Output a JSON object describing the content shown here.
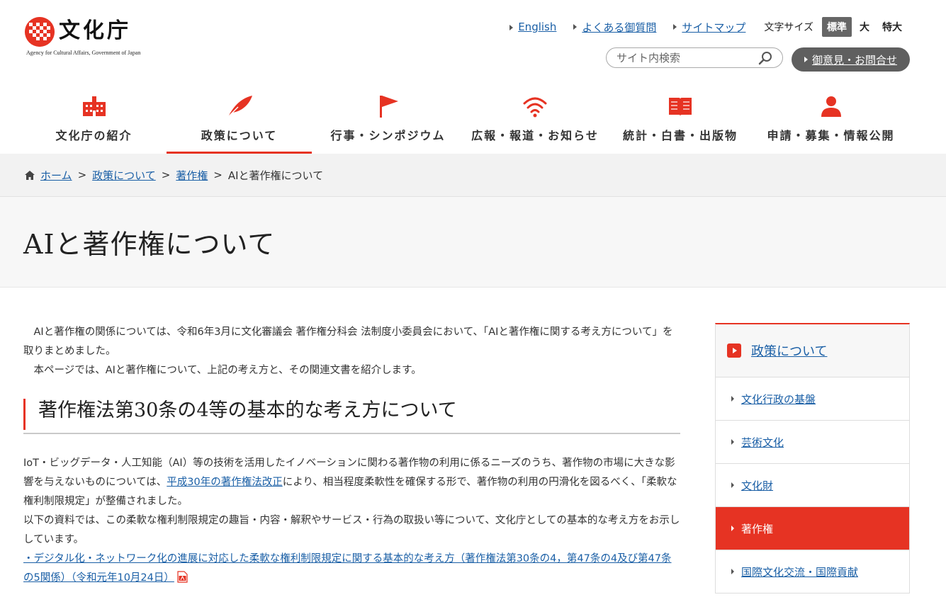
{
  "header": {
    "logo_text": "文化庁",
    "logo_subtitle": "Agency for Cultural Affairs, Government of Japan",
    "links": [
      "English",
      "よくある御質問",
      "サイトマップ"
    ],
    "font_size_label": "文字サイズ",
    "font_sizes": [
      "標準",
      "大",
      "特大"
    ],
    "search_placeholder": "サイト内検索",
    "contact_label": "御意見・お問合せ"
  },
  "nav": {
    "items": [
      {
        "label": "文化庁の紹介",
        "icon": "building-icon"
      },
      {
        "label": "政策について",
        "icon": "quill-icon"
      },
      {
        "label": "行事・シンポジウム",
        "icon": "flag-icon"
      },
      {
        "label": "広報・報道・お知らせ",
        "icon": "broadcast-icon"
      },
      {
        "label": "統計・白書・出版物",
        "icon": "book-icon"
      },
      {
        "label": "申請・募集・情報公開",
        "icon": "person-icon"
      }
    ],
    "active_index": 1
  },
  "breadcrumb": {
    "items": [
      "ホーム",
      "政策について",
      "著作権"
    ],
    "current": "AIと著作権について"
  },
  "page": {
    "title": "AIと著作権について"
  },
  "content": {
    "intro": [
      "AIと著作権の関係については、令和6年3月に文化審議会 著作権分科会 法制度小委員会において、「AIと著作権に関する考え方について」を取りまとめました。",
      "本ページでは、AIと著作権について、上記の考え方と、その関連文書を紹介します。"
    ],
    "section_heading": "著作権法第30条の4等の基本的な考え方について",
    "para1_before": "IoT・ビッグデータ・人工知能（AI）等の技術を活用したイノベーションに関わる著作物の利用に係るニーズのうち、著作物の市場に大きな影響を与えないものについては、",
    "para1_link": "平成30年の著作権法改正",
    "para1_after": "により、相当程度柔軟性を確保する形で、著作物の利用の円滑化を図るべく、「柔軟な権利制限規定」が整備されました。",
    "para2": "以下の資料では、この柔軟な権利制限規定の趣旨・内容・解釈やサービス・行為の取扱い等について、文化庁としての基本的な考え方をお示ししています。",
    "doc_link": "・デジタル化・ネットワーク化の進展に対応した柔軟な権利制限規定に関する基本的な考え方（著作権法第30条の4，第47条の4及び第47条の5関係）（令和元年10月24日）"
  },
  "sidebar": {
    "heading": "政策について",
    "items": [
      "文化行政の基盤",
      "芸術文化",
      "文化財",
      "著作権",
      "国際文化交流・国際貢献"
    ],
    "active_index": 3
  },
  "colors": {
    "accent": "#e63323",
    "link": "#1a5fa6",
    "button_dark": "#5f5f5f"
  }
}
